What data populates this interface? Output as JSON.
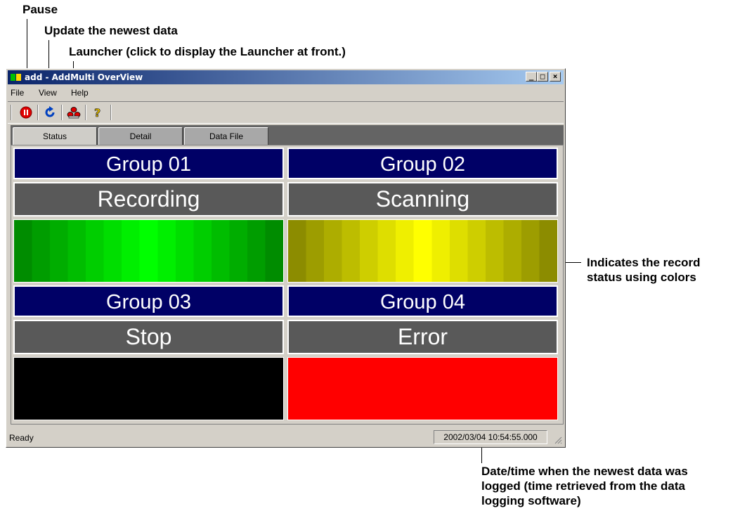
{
  "callouts": {
    "pause": "Pause",
    "update": "Update the newest data",
    "launcher": "Launcher (click to display the Launcher at front.)",
    "record_status_line1": "Indicates the record",
    "record_status_line2": "status using colors",
    "datetime_line1": "Date/time when the newest data was",
    "datetime_line2": "logged (time retrieved from the data",
    "datetime_line3": "logging software)"
  },
  "window": {
    "title": "add - AddMulti OverView",
    "controls": {
      "minimize": "_",
      "maximize": "□",
      "close": "×"
    }
  },
  "menu": [
    "File",
    "View",
    "Help"
  ],
  "toolbar": {
    "buttons": [
      {
        "icon": "pause-icon"
      },
      {
        "icon": "refresh-icon"
      },
      {
        "icon": "launcher-icon"
      },
      {
        "icon": "help-icon"
      }
    ]
  },
  "tabs": [
    {
      "label": "Status",
      "active": true
    },
    {
      "label": "Detail",
      "active": false
    },
    {
      "label": "Data File",
      "active": false
    }
  ],
  "groups": [
    {
      "name": "Group 01",
      "status": "Recording",
      "color": "#00ff00"
    },
    {
      "name": "Group 02",
      "status": "Scanning",
      "color": "#ffff00"
    },
    {
      "name": "Group 03",
      "status": "Stop",
      "color": "#000000"
    },
    {
      "name": "Group 04",
      "status": "Error",
      "color": "#ff0000"
    }
  ],
  "statusbar": {
    "left": "Ready",
    "time": "2002/03/04 10:54:55.000"
  }
}
